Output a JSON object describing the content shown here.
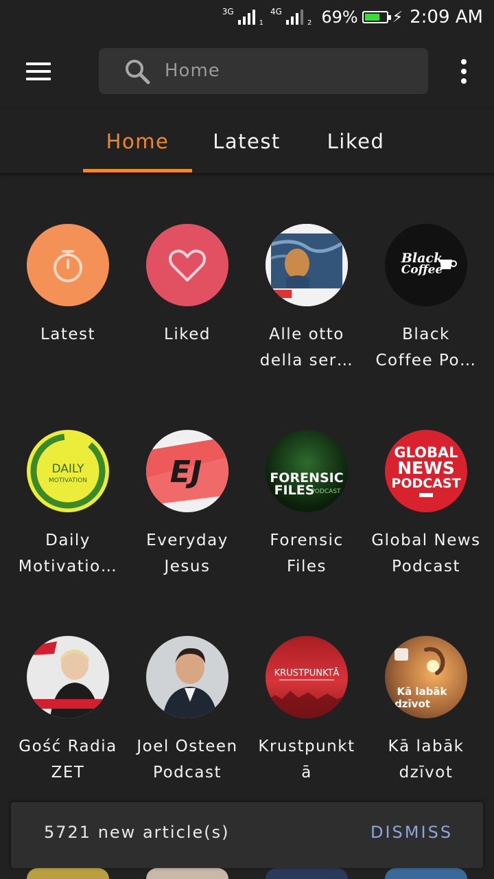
{
  "status_bar": {
    "network1": "3G",
    "sim1": "1",
    "network2": "4G",
    "sim2": "2",
    "battery_percent": "69%",
    "battery_level": 0.69,
    "charging_icon": "lightning-bolt-icon",
    "time": "2:09 AM"
  },
  "toolbar": {
    "menu_icon": "hamburger-menu-icon",
    "search_placeholder": "Home",
    "overflow_icon": "more-vert-icon"
  },
  "tabs": [
    {
      "label": "Home",
      "active": true
    },
    {
      "label": "Latest",
      "active": false
    },
    {
      "label": "Liked",
      "active": false
    }
  ],
  "accent_color": "#f0892e",
  "feeds": [
    {
      "line1": "Latest",
      "line2": "",
      "icon": "stopwatch-icon",
      "color": "#f39157"
    },
    {
      "line1": "Liked",
      "line2": "",
      "icon": "heart-icon",
      "color": "#e15162"
    },
    {
      "line1": "Alle otto",
      "line2": "della ser…",
      "icon": "painting-cover-art"
    },
    {
      "line1": "Black",
      "line2": "Coffee Po…",
      "icon": "black-coffee-logo",
      "logo_text": "Black Coffee"
    },
    {
      "line1": "Daily",
      "line2": "Motivatio…",
      "icon": "daily-motivation-logo",
      "logo_text": "DAILY MOTIVATION"
    },
    {
      "line1": "Everyday",
      "line2": "Jesus",
      "icon": "ej-logo",
      "logo_text": "EJ"
    },
    {
      "line1": "Forensic",
      "line2": "Files",
      "icon": "forensic-files-logo",
      "logo_text": "FORENSIC FILES"
    },
    {
      "line1": "Global News",
      "line2": "Podcast",
      "icon": "global-news-logo",
      "logo_text": "GLOBAL NEWS PODCAST"
    },
    {
      "line1": "Gość Radia",
      "line2": "ZET",
      "icon": "zet-portrait-cover",
      "logo_text": "GOŚĆ RADIA ZET"
    },
    {
      "line1": "Joel Osteen",
      "line2": "Podcast",
      "icon": "joel-osteen-portrait-cover",
      "logo_text": "JOEL OSTEEN"
    },
    {
      "line1": "Krustpunkt",
      "line2": "ā",
      "icon": "krustpunkta-cover",
      "logo_text": "KRUSTPUNKTĀ"
    },
    {
      "line1": "Kā labāk",
      "line2": "dzīvot",
      "icon": "ka-labak-dzivot-cover",
      "logo_text": "Kā labāk dzīvot"
    }
  ],
  "snackbar": {
    "message": "5721 new article(s)",
    "action": "DISMISS"
  }
}
